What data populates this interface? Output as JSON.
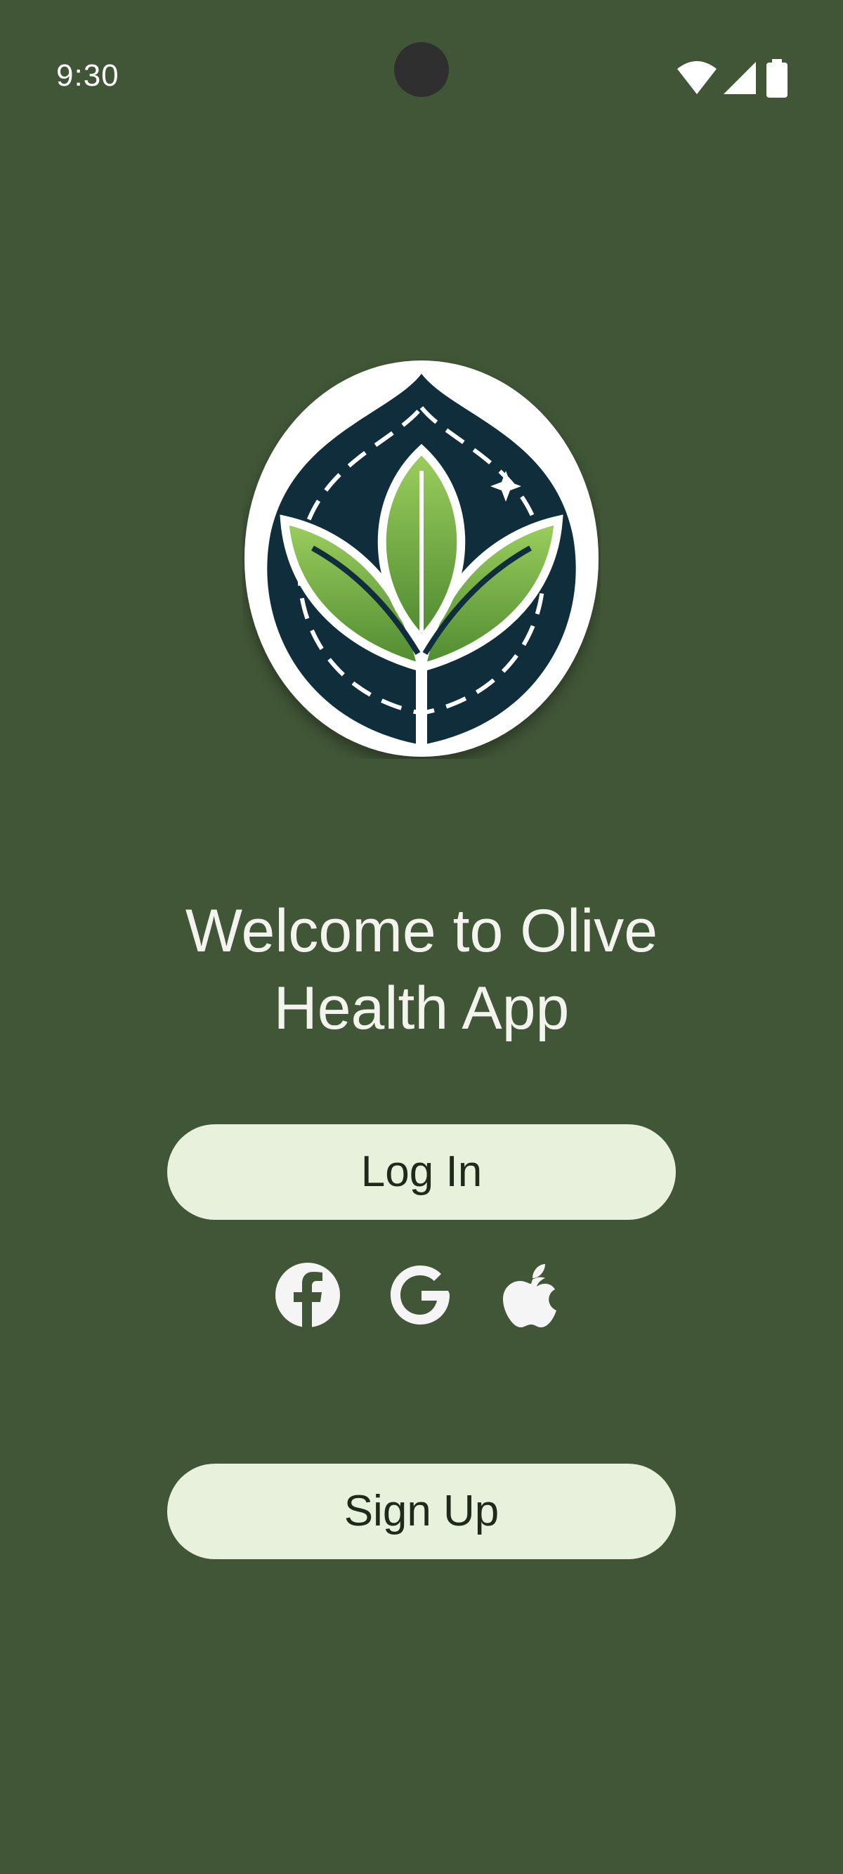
{
  "status_bar": {
    "time": "9:30",
    "icons": [
      "wifi-icon",
      "cellular-signal-icon",
      "battery-icon"
    ]
  },
  "welcome": {
    "line1": "Welcome to Olive",
    "line2": "Health App"
  },
  "buttons": {
    "login": "Log In",
    "signup": "Sign Up"
  },
  "social_login": [
    "facebook-icon",
    "google-icon",
    "apple-icon"
  ],
  "colors": {
    "background": "#415637",
    "button": "#e8f1dc",
    "button_text": "#1f2a1b",
    "logo_navy": "#0f2d3a",
    "leaf_green": "#7db34a"
  }
}
